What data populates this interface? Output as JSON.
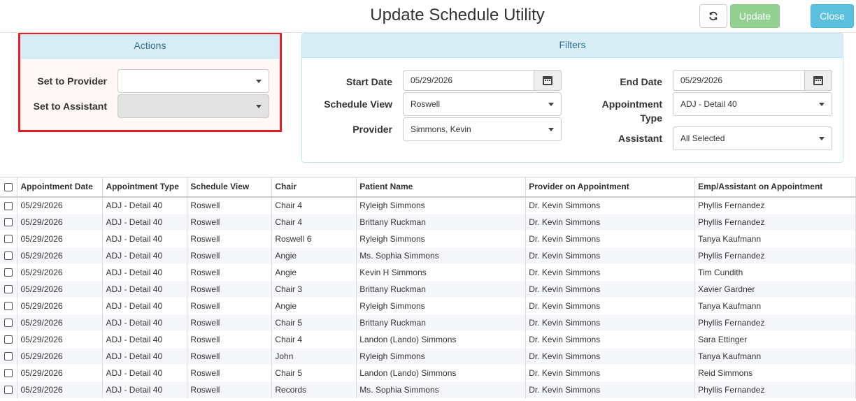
{
  "header": {
    "title": "Update Schedule Utility",
    "update_label": "Update",
    "close_label": "Close"
  },
  "actions": {
    "title": "Actions",
    "set_provider_label": "Set to Provider",
    "set_provider_value": "",
    "set_assistant_label": "Set to Assistant",
    "set_assistant_value": ""
  },
  "filters": {
    "title": "Filters",
    "start_date_label": "Start Date",
    "start_date_value": "05/29/2026",
    "schedule_view_label": "Schedule View",
    "schedule_view_value": "Roswell",
    "provider_label": "Provider",
    "provider_value": "Simmons, Kevin",
    "end_date_label": "End Date",
    "end_date_value": "05/29/2026",
    "appointment_type_label_1": "Appointment",
    "appointment_type_label_2": "Type",
    "appointment_type_value": "ADJ - Detail 40",
    "assistant_label": "Assistant",
    "assistant_value": "All Selected"
  },
  "table": {
    "columns": [
      "Appointment Date",
      "Appointment Type",
      "Schedule View",
      "Chair",
      "Patient Name",
      "Provider on Appointment",
      "Emp/Assistant on Appointment"
    ],
    "rows": [
      [
        "05/29/2026",
        "ADJ - Detail 40",
        "Roswell",
        "Chair 4",
        "Ryleigh Simmons",
        "Dr. Kevin Simmons",
        "Phyllis Fernandez"
      ],
      [
        "05/29/2026",
        "ADJ - Detail 40",
        "Roswell",
        "Chair 4",
        "Brittany Ruckman",
        "Dr. Kevin Simmons",
        "Phyllis Fernandez"
      ],
      [
        "05/29/2026",
        "ADJ - Detail 40",
        "Roswell",
        "Roswell 6",
        "Ryleigh Simmons",
        "Dr. Kevin Simmons",
        "Tanya Kaufmann"
      ],
      [
        "05/29/2026",
        "ADJ - Detail 40",
        "Roswell",
        "Angie",
        "Ms. Sophia Simmons",
        "Dr. Kevin Simmons",
        "Phyllis Fernandez"
      ],
      [
        "05/29/2026",
        "ADJ - Detail 40",
        "Roswell",
        "Angie",
        "Kevin H Simmons",
        "Dr. Kevin Simmons",
        "Tim Cundith"
      ],
      [
        "05/29/2026",
        "ADJ - Detail 40",
        "Roswell",
        "Chair 3",
        "Brittany Ruckman",
        "Dr. Kevin Simmons",
        "Xavier Gardner"
      ],
      [
        "05/29/2026",
        "ADJ - Detail 40",
        "Roswell",
        "Angie",
        "Ryleigh Simmons",
        "Dr. Kevin Simmons",
        "Tanya Kaufmann"
      ],
      [
        "05/29/2026",
        "ADJ - Detail 40",
        "Roswell",
        "Chair 5",
        "Brittany Ruckman",
        "Dr. Kevin Simmons",
        "Phyllis Fernandez"
      ],
      [
        "05/29/2026",
        "ADJ - Detail 40",
        "Roswell",
        "Chair 4",
        "Landon (Lando) Simmons",
        "Dr. Kevin Simmons",
        "Sara Ettinger"
      ],
      [
        "05/29/2026",
        "ADJ - Detail 40",
        "Roswell",
        "John",
        "Ryleigh Simmons",
        "Dr. Kevin Simmons",
        "Tanya Kaufmann"
      ],
      [
        "05/29/2026",
        "ADJ - Detail 40",
        "Roswell",
        "Chair 5",
        "Landon (Lando) Simmons",
        "Dr. Kevin Simmons",
        "Reid Simmons"
      ],
      [
        "05/29/2026",
        "ADJ - Detail 40",
        "Roswell",
        "Records",
        "Ms. Sophia Simmons",
        "Dr. Kevin Simmons",
        "Phyllis Fernandez"
      ]
    ]
  },
  "colors": {
    "update_button": "#93d192",
    "close_button": "#5bc0de",
    "panel_header": "#d9edf7",
    "highlight_outline": "#e3202a"
  }
}
